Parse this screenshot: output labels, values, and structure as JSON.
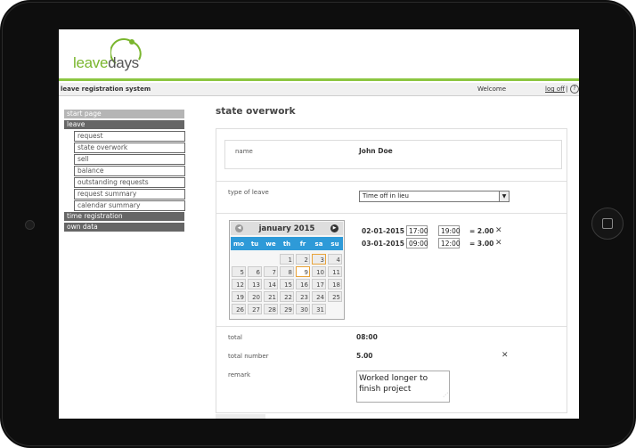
{
  "header": {
    "logo_leave": "leave",
    "logo_days": "days"
  },
  "topbar": {
    "system_title": "leave registration system",
    "welcome": "Welcome",
    "logoff": "log off",
    "separator": "|",
    "help": "?"
  },
  "nav": {
    "start_page": "start page",
    "leave": "leave",
    "leave_items": [
      "request",
      "state overwork",
      "sell",
      "balance",
      "outstanding requests",
      "request summary",
      "calendar summary"
    ],
    "time_registration": "time registration",
    "own_data": "own data"
  },
  "page": {
    "title": "state overwork"
  },
  "form": {
    "name_label": "name",
    "name_value": "John Doe",
    "type_label": "type of leave",
    "type_value": "Time off in lieu",
    "total_label": "total",
    "total_value": "08:00",
    "total_number_label": "total number",
    "total_number_value": "5.00",
    "remark_label": "remark",
    "remark_value": "Worked longer to finish project"
  },
  "calendar": {
    "title": "january 2015",
    "weekdays": [
      "mo",
      "tu",
      "we",
      "th",
      "fr",
      "sa",
      "su"
    ],
    "days": [
      "1",
      "2",
      "3",
      "4",
      "5",
      "6",
      "7",
      "8",
      "9",
      "10",
      "11",
      "12",
      "13",
      "14",
      "15",
      "16",
      "17",
      "18",
      "19",
      "20",
      "21",
      "22",
      "23",
      "24",
      "25",
      "26",
      "27",
      "28",
      "29",
      "30",
      "31"
    ],
    "selected_day": "9",
    "highlighted_day": "3"
  },
  "entries": [
    {
      "date": "02-01-2015",
      "from": "17:00",
      "to": "19:00",
      "total": "= 2.00"
    },
    {
      "date": "03-01-2015",
      "from": "09:00",
      "to": "12:00",
      "total": "= 3.00"
    }
  ],
  "icons": {
    "remove": "close-icon",
    "prev": "chevron-left-icon",
    "next": "chevron-right-icon"
  },
  "colors": {
    "brand_green": "#8cc641",
    "calendar_header": "#2e9ad8",
    "nav_dark": "#666666"
  }
}
